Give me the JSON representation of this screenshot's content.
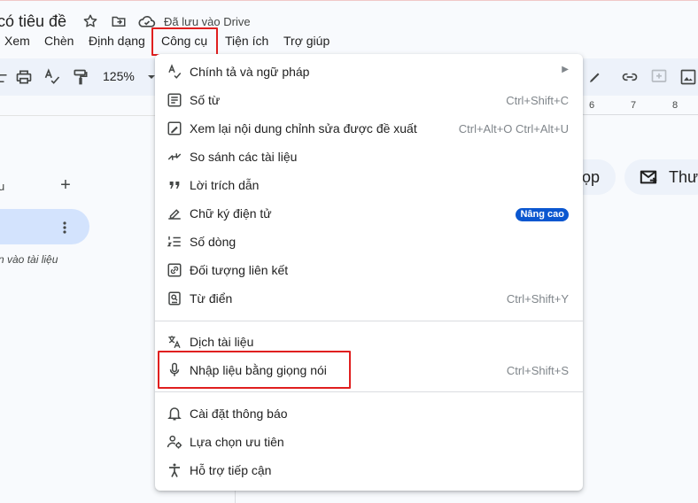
{
  "header": {
    "doc_title": "có tiêu đề",
    "drive_status": "Đã lưu vào Drive"
  },
  "menubar": {
    "items": [
      "Xem",
      "Chèn",
      "Định dạng",
      "Công cụ",
      "Tiện ích",
      "Trợ giúp"
    ]
  },
  "toolbar": {
    "zoom": "125%"
  },
  "ruler": {
    "marks": [
      "6",
      "7",
      "8"
    ]
  },
  "outline": {
    "label": "u",
    "hint": "n vào tài liệu"
  },
  "chips": {
    "chip1": "ọp",
    "chip2": "Thư"
  },
  "tools_menu": {
    "items": [
      {
        "label": "Chính tả và ngữ pháp",
        "icon": "spellcheck-icon",
        "submenu": true
      },
      {
        "label": "Số từ",
        "icon": "word-count-icon",
        "shortcut": "Ctrl+Shift+C"
      },
      {
        "label": "Xem lại nội dung chỉnh sửa được đề xuất",
        "icon": "review-edits-icon",
        "shortcut": "Ctrl+Alt+O Ctrl+Alt+U"
      },
      {
        "label": "So sánh các tài liệu",
        "icon": "compare-icon"
      },
      {
        "label": "Lời trích dẫn",
        "icon": "citation-icon"
      },
      {
        "label": "Chữ ký điện tử",
        "icon": "signature-icon",
        "badge": "Nâng cao"
      },
      {
        "label": "Số dòng",
        "icon": "line-numbers-icon"
      },
      {
        "label": "Đối tượng liên kết",
        "icon": "linked-objects-icon"
      },
      {
        "label": "Từ điển",
        "icon": "dictionary-icon",
        "shortcut": "Ctrl+Shift+Y"
      },
      {
        "label": "Dịch tài liệu",
        "icon": "translate-icon"
      },
      {
        "label": "Nhập liệu bằng giọng nói",
        "icon": "microphone-icon",
        "shortcut": "Ctrl+Shift+S"
      },
      {
        "label": "Cài đặt thông báo",
        "icon": "bell-icon"
      },
      {
        "label": "Lựa chọn ưu tiên",
        "icon": "preferences-icon"
      },
      {
        "label": "Hỗ trợ tiếp cận",
        "icon": "accessibility-icon"
      }
    ]
  },
  "colors": {
    "highlight": "#e01f1f",
    "badge": "#0b57d0",
    "toolbar_bg": "#edf2fa",
    "selected_tab": "#d3e3fd"
  }
}
